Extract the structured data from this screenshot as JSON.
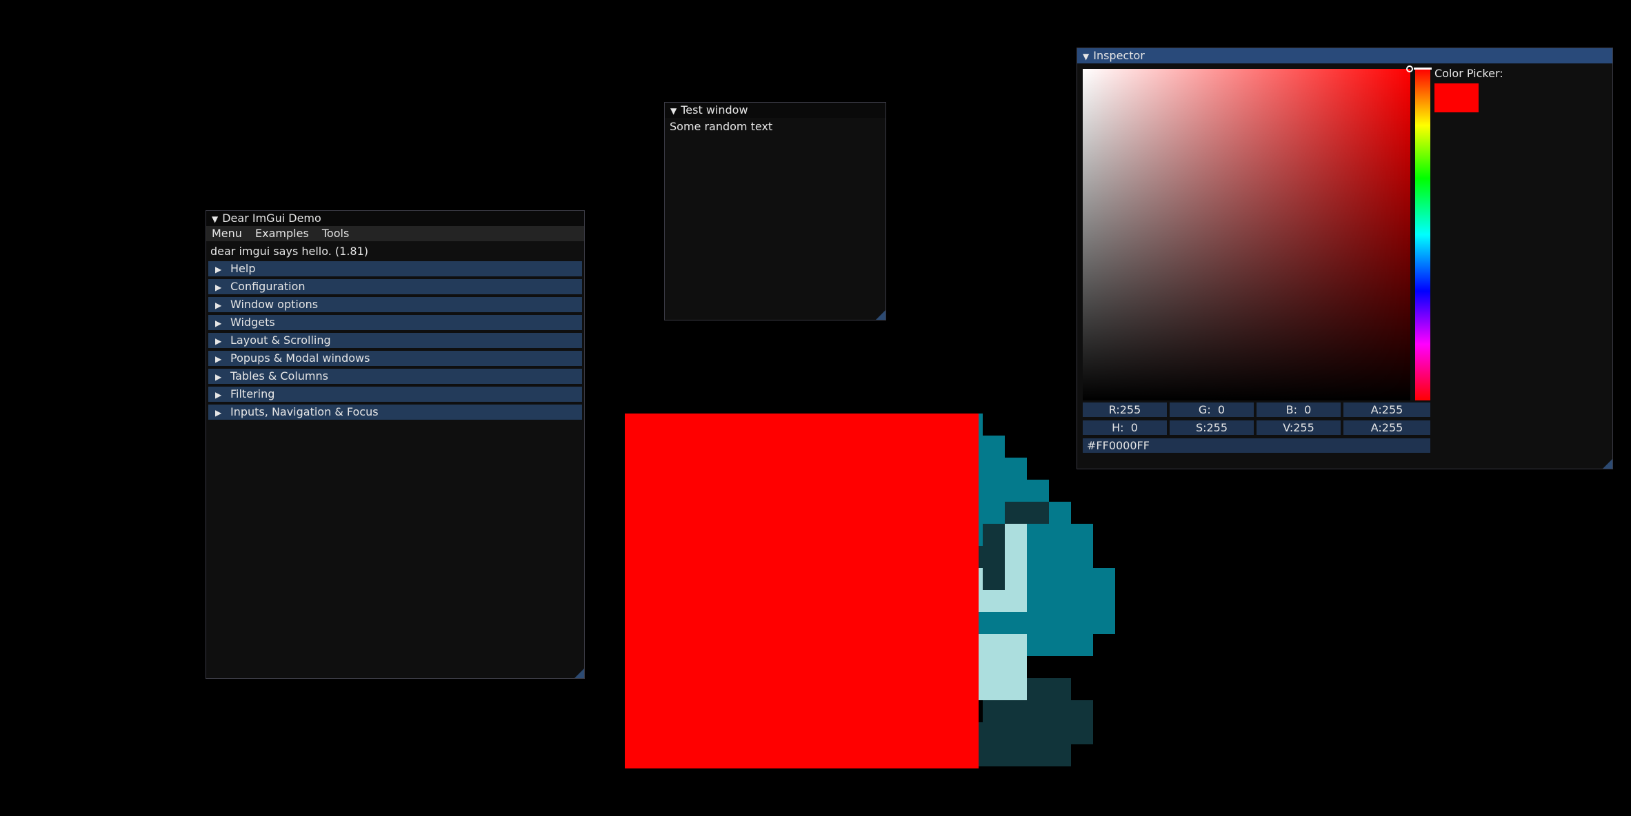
{
  "demo_window": {
    "title": "Dear ImGui Demo",
    "menu": [
      "Menu",
      "Examples",
      "Tools"
    ],
    "hello": "dear imgui says hello. (1.81)",
    "headers": [
      "Help",
      "Configuration",
      "Window options",
      "Widgets",
      "Layout & Scrolling",
      "Popups & Modal windows",
      "Tables & Columns",
      "Filtering",
      "Inputs, Navigation & Focus"
    ]
  },
  "test_window": {
    "title": "Test window",
    "text": "Some random text"
  },
  "inspector": {
    "title": "Inspector",
    "picker_label": "Color Picker:",
    "rgba": [
      "R:255",
      "G:  0",
      "B:  0",
      "A:255"
    ],
    "hsva": [
      "H:  0",
      "S:255",
      "V:255",
      "A:255"
    ],
    "hex": "#FF0000FF",
    "color": "#ff0000"
  },
  "colors": {
    "background": "#000000",
    "window_bg": "#0f0f0f",
    "header": "#233b5a",
    "title_active": "#294a7a",
    "sprite_red": "#ff0000",
    "sprite_teal": "#047a8c",
    "sprite_dark": "#11343a",
    "sprite_light": "#acdede"
  },
  "icons": {
    "collapse": "triangle-down-icon",
    "tree_node": "triangle-right-icon",
    "resize_grip": "resize-grip-icon"
  }
}
